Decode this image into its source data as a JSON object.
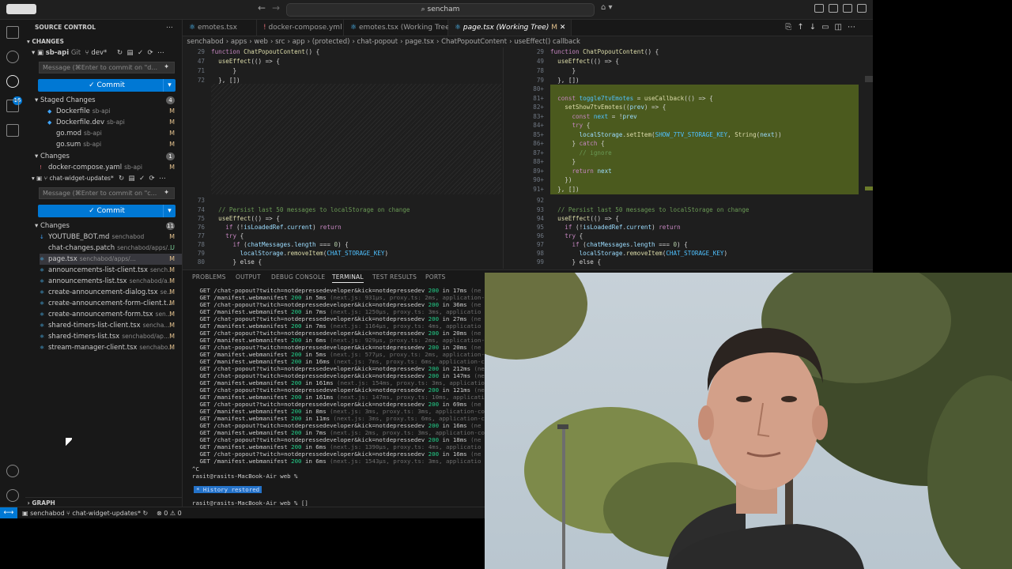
{
  "titlebar": {
    "search_text": "sencham",
    "back_icon": "arrow-left-icon",
    "forward_icon": "arrow-right-icon"
  },
  "scm": {
    "header": "SOURCE CONTROL",
    "changes_header": "CHANGES",
    "repo1": {
      "name": "sb-api",
      "provider": "Git",
      "branch": "dev*"
    },
    "message_placeholder": "Message (⌘Enter to commit on \"d...",
    "commit_label": "✓ Commit",
    "staged_label": "Staged Changes",
    "staged_count": "4",
    "staged_files": [
      {
        "name": "Dockerfile",
        "path": "sb-api",
        "status": "M"
      },
      {
        "name": "Dockerfile.dev",
        "path": "sb-api",
        "status": "M"
      },
      {
        "name": "go.mod",
        "path": "sb-api",
        "status": "M"
      },
      {
        "name": "go.sum",
        "path": "sb-api",
        "status": "M"
      }
    ],
    "changes_label": "Changes",
    "changes_count": "1",
    "changes_files": [
      {
        "name": "docker-compose.yaml",
        "path": "sb-api",
        "status": "M"
      }
    ],
    "repo2": {
      "name": "chat-widget-updates*"
    },
    "message2_placeholder": "Message (⌘Enter to commit on \"c...",
    "commit2_label": "✓ Commit",
    "changes2_label": "Changes",
    "changes2_count": "11",
    "changes2_files": [
      {
        "name": "YOUTUBE_BOT.md",
        "path": "senchabod",
        "status": "M"
      },
      {
        "name": "chat-changes.patch",
        "path": "senchabod/apps/...",
        "status": "U"
      },
      {
        "name": "page.tsx",
        "path": "senchabod/apps/...",
        "status": "M"
      },
      {
        "name": "announcements-list-client.tsx",
        "path": "sench...",
        "status": "M"
      },
      {
        "name": "announcements-list.tsx",
        "path": "senchabod/a...",
        "status": "M"
      },
      {
        "name": "create-announcement-dialog.tsx",
        "path": "se...",
        "status": "M"
      },
      {
        "name": "create-announcement-form-client.t...",
        "path": "",
        "status": "M"
      },
      {
        "name": "create-announcement-form.tsx",
        "path": "sen...",
        "status": "M"
      },
      {
        "name": "shared-timers-list-client.tsx",
        "path": "sencha...",
        "status": "M"
      },
      {
        "name": "shared-timers-list.tsx",
        "path": "senchabod/ap...",
        "status": "M"
      },
      {
        "name": "stream-manager-client.tsx",
        "path": "senchabo...",
        "status": "M"
      }
    ],
    "graph_label": "GRAPH"
  },
  "tabs": [
    {
      "label": "emotes.tsx"
    },
    {
      "label": "docker-compose.yml"
    },
    {
      "label": "emotes.tsx (Working Tree)"
    },
    {
      "label": "page.tsx (Working Tree)",
      "status": "M"
    }
  ],
  "breadcrumb": [
    "senchabod",
    "apps",
    "web",
    "src",
    "app",
    "(protected)",
    "chat-popout",
    "page.tsx",
    "ChatPopoutContent",
    "useEffect() callback"
  ],
  "panel": {
    "tabs": [
      "PROBLEMS",
      "OUTPUT",
      "DEBUG CONSOLE",
      "TERMINAL",
      "TEST RESULTS",
      "PORTS"
    ],
    "history_restored": "* History restored",
    "prompt1": "rasit@rasits-MacBook-Air web %",
    "prompt2": "rasit@rasits-MacBook-Air web % []",
    "ctrl_c": "^C"
  },
  "statusbar": {
    "repo": "senchabod",
    "branch": "chat-widget-updates*",
    "problems": "⊗ 0 ⚠ 0"
  },
  "colors": {
    "accent": "#0078d4",
    "added_bg": "#4b5a1e",
    "status_ok": "#23d18b"
  }
}
